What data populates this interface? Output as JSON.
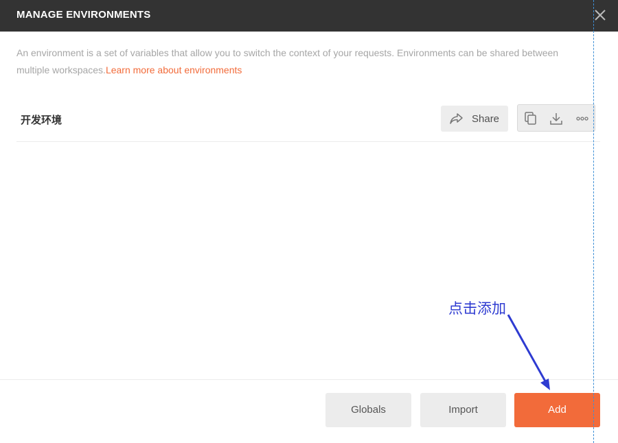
{
  "header": {
    "title": "MANAGE ENVIRONMENTS",
    "close_icon": "close-icon"
  },
  "description": {
    "text": "An environment is a set of variables that allow you to switch the context of your requests. Environments can be shared between multiple workspaces.",
    "link_text": "Learn more about environments"
  },
  "environments": [
    {
      "name": "开发环境",
      "share_label": "Share",
      "icons": [
        "duplicate-icon",
        "download-icon",
        "more-icon"
      ]
    }
  ],
  "footer": {
    "globals_label": "Globals",
    "import_label": "Import",
    "add_label": "Add"
  },
  "annotation": {
    "text": "点击添加",
    "color": "#2e3bd1"
  },
  "colors": {
    "accent": "#f26b3a",
    "header_bg": "#333333"
  }
}
